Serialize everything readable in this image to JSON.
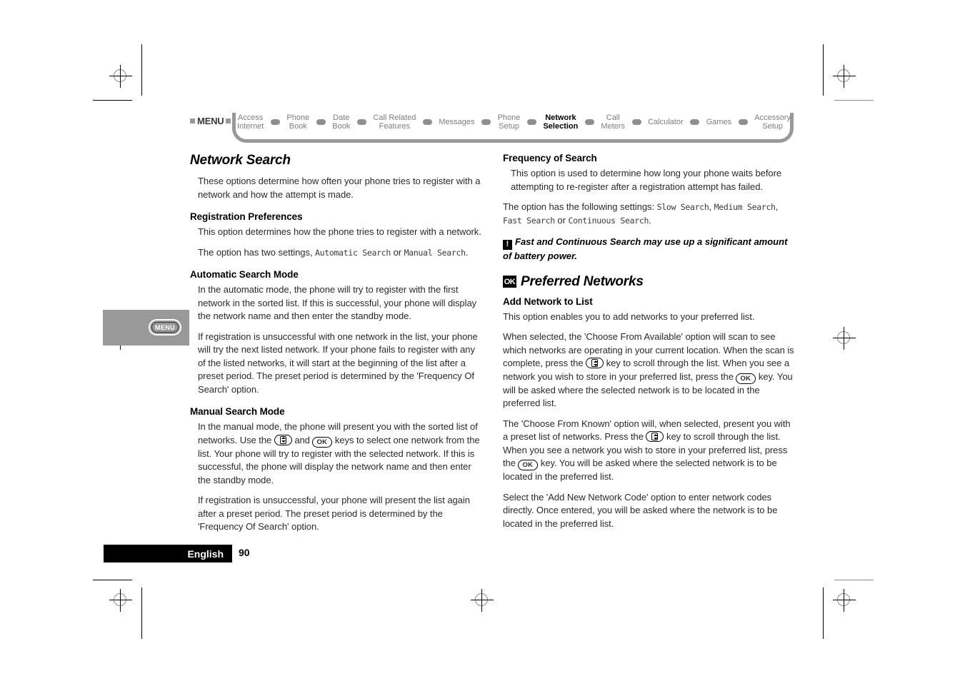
{
  "document": {
    "language_footer": "English",
    "page_number": "90"
  },
  "margin_tab": {
    "menu_label": "MENU"
  },
  "pathbar": {
    "menu_label": "MENU",
    "crumbs": [
      {
        "label": "Access\nInternet",
        "current": false
      },
      {
        "label": "Phone\nBook",
        "current": false
      },
      {
        "label": "Date\nBook",
        "current": false
      },
      {
        "label": "Call Related\nFeatures",
        "current": false
      },
      {
        "label": "Messages",
        "current": false
      },
      {
        "label": "Phone\nSetup",
        "current": false
      },
      {
        "label": "Network\nSelection",
        "current": true
      },
      {
        "label": "Call\nMeters",
        "current": false
      },
      {
        "label": "Calculator",
        "current": false
      },
      {
        "label": "Games",
        "current": false
      },
      {
        "label": "Accessory\nSetup",
        "current": false
      }
    ]
  },
  "left_column": {
    "heading": "Network Search",
    "intro": "These options determine how often your phone tries to register with a network and how the attempt is made.",
    "registration_preferences": {
      "heading": "Registration Preferences",
      "p1": "This option determines how the phone tries to register with a network.",
      "p2_before": "The option has two settings, ",
      "p2_setting1": "Automatic Search",
      "p2_middle": " or ",
      "p2_setting2": "Manual Search",
      "p2_after": "."
    },
    "automatic_search_mode": {
      "heading": "Automatic Search Mode",
      "p1": "In the automatic mode, the phone will try to register with the first network in the sorted list. If this is successful, your phone will display the network name and then enter the standby mode.",
      "p2": "If registration is unsuccessful with one network in the list, your phone will try the next listed network. If your phone fails to register with any of the listed networks, it will start at the beginning of the list after a preset period. The preset period is determined by the 'Frequency Of Search' option."
    },
    "manual_search_mode": {
      "heading": "Manual Search Mode",
      "p1_a": "In the manual mode, the phone will present you with the sorted list of networks. Use the ",
      "p1_b": " and ",
      "p1_c": " keys to select one network from the list. Your phone will try to register with the selected network. If this is successful, the phone will display the network name and then enter the standby mode.",
      "p2": "If registration is unsuccessful, your phone will present the list again after a preset period. The preset period is determined by the 'Frequency Of Search' option."
    }
  },
  "right_column": {
    "frequency_of_search": {
      "heading": "Frequency of Search",
      "p1": "This option is used to determine how long your phone waits before attempting to re-register after a registration attempt has failed.",
      "p2_before": "The option has the following settings: ",
      "p2_setting1": "Slow Search",
      "p2_sep1": ", ",
      "p2_setting2": "Medium Search",
      "p2_sep2": ", ",
      "p2_setting3": "Fast Search",
      "p2_sep3": " or ",
      "p2_setting4": "Continuous Search",
      "p2_after": ".",
      "note": "Fast and Continuous Search may use up a significant amount of battery power."
    },
    "preferred_networks": {
      "heading": "Preferred Networks",
      "add_network_to_list": {
        "heading": "Add Network to List",
        "p1": "This option enables you to add networks to your preferred list.",
        "p2_a": "When selected, the 'Choose From Available' option will scan to see which networks are operating in your current location. When the scan is complete, press the ",
        "p2_b": " key to scroll through the list. When you see a network you wish to store in your preferred list, press the ",
        "p2_c": " key. You will be asked where the selected network is to be located in the preferred list.",
        "p3_a": "The 'Choose From Known' option will, when selected, present you with a preset list of networks. Press the ",
        "p3_b": " key to scroll through the list. When you see a network you wish to store in your preferred list, press the ",
        "p3_c": " key. You will be asked where the selected network is to be located in the preferred list.",
        "p4": "Select the 'Add New Network Code' option to enter network codes directly. Once entered, you will be asked where the network is to be located in the preferred list."
      }
    }
  },
  "icons": {
    "ok_key": "OK",
    "ok_badge": "OK",
    "warning": "!"
  }
}
